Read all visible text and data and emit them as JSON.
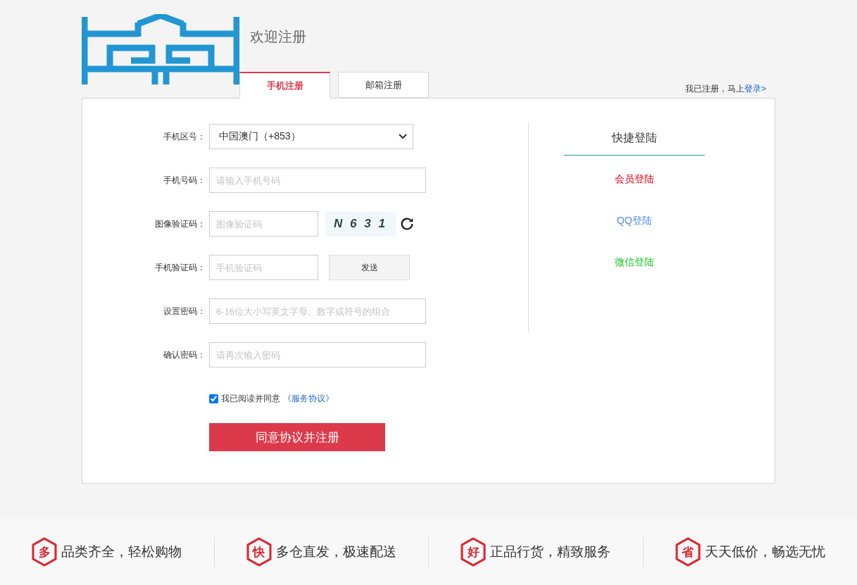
{
  "header": {
    "title": "欢迎注册",
    "tabs": [
      {
        "label": "手机注册",
        "selected": true
      },
      {
        "label": "邮箱注册",
        "selected": false
      }
    ],
    "login_prompt": "我已注册，马上",
    "login_link": "登录>"
  },
  "form": {
    "fields": [
      {
        "kind": "select",
        "label": "手机区号：",
        "value": "中国澳门（+853）"
      },
      {
        "kind": "text",
        "label": "手机号码：",
        "placeholder": "请输入手机号码"
      },
      {
        "kind": "captcha",
        "label": "图像验证码：",
        "placeholder": "图像验证码",
        "captcha": "N 6 3 1"
      },
      {
        "kind": "sms",
        "label": "手机验证码：",
        "placeholder": "手机验证码",
        "button": "发送"
      },
      {
        "kind": "password",
        "label": "设置密码：",
        "placeholder": "6-16位大小写英文字母、数字或符号的组合"
      },
      {
        "kind": "password",
        "label": "确认密码：",
        "placeholder": "请再次输入密码"
      }
    ],
    "agree": {
      "checked": true,
      "text": "我已阅读并同意",
      "link": "《服务协议》"
    },
    "submit": "同意协议并注册"
  },
  "quick_login": {
    "title": "快捷登陆",
    "links": [
      {
        "label": "会员登陆",
        "color": "#e60012"
      },
      {
        "label": "QQ登陆",
        "color": "#4a8fe7"
      },
      {
        "label": "微信登陆",
        "color": "#19c41e"
      }
    ]
  },
  "footer": [
    {
      "badge": "多",
      "text": "品类齐全，轻松购物"
    },
    {
      "badge": "快",
      "text": "多仓直发，极速配送"
    },
    {
      "badge": "好",
      "text": "正品行货，精致服务"
    },
    {
      "badge": "省",
      "text": "天天低价，畅选无忧"
    }
  ]
}
